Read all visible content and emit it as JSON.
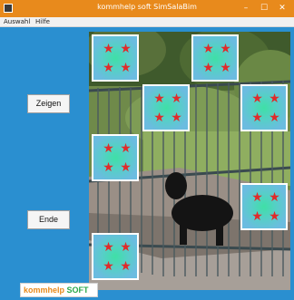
{
  "window": {
    "title": "kommhelp soft SimSalaBim",
    "controls": {
      "minimize": "–",
      "maximize": "☐",
      "close": "✕"
    }
  },
  "menu": {
    "items": [
      "Auswahl",
      "Hilfe"
    ]
  },
  "buttons": {
    "show": "Zeigen",
    "end": "Ende"
  },
  "logo": {
    "part1": "kommhelp",
    "part2": "SOFT"
  },
  "cards": {
    "count_visible": 7,
    "star_glyph": "★"
  },
  "colors": {
    "titlebar": "#e88a1c",
    "background": "#2a8fd0",
    "card_center": "#3fe0a6",
    "star": "#e02a2a"
  }
}
